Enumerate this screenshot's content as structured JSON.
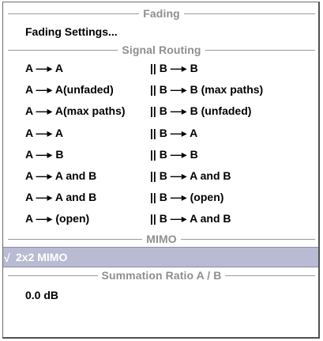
{
  "sections": {
    "fading": "Fading",
    "signal_routing": "Signal Routing",
    "mimo": "MIMO",
    "summation": "Summation Ratio A / B"
  },
  "fading_settings": "Fading Settings...",
  "routing": [
    {
      "a": "A —▸ A",
      "b": "|| B —▸ B"
    },
    {
      "a": "A —▸ A(unfaded)",
      "b": "|| B —▸ B (max paths)"
    },
    {
      "a": "A —▸ A(max paths)",
      "b": "|| B —▸ B (unfaded)"
    },
    {
      "a": "A —▸ A",
      "b": "|| B —▸ A"
    },
    {
      "a": "A —▸ B",
      "b": "|| B —▸ B"
    },
    {
      "a": "A —▸ A and B",
      "b": "|| B —▸ A and B"
    },
    {
      "a": "A —▸ A and B",
      "b": "|| B —▸ (open)"
    },
    {
      "a": "A —▸ (open)",
      "b": "|| B —▸ A and B"
    }
  ],
  "mimo_item": {
    "check": "√",
    "label": "2x2 MIMO"
  },
  "summation_value": "0.0 dB",
  "colors": {
    "selected_bg": "#b9bbd3",
    "section_text": "#8f8f8f"
  }
}
